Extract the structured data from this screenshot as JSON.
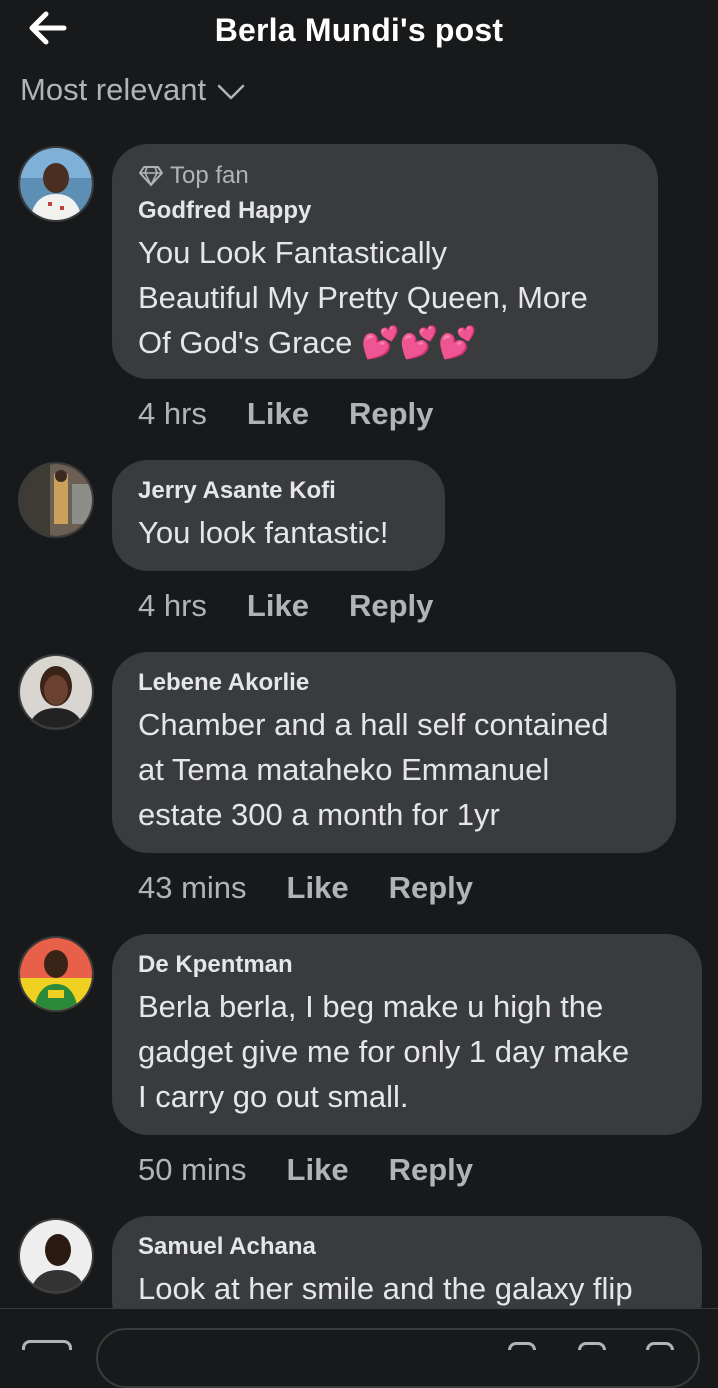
{
  "header": {
    "title": "Berla Mundi's post"
  },
  "sort": {
    "label": "Most relevant"
  },
  "comments": [
    {
      "badge": "Top fan",
      "name": "Godfred Happy",
      "lines": [
        "You Look Fantastically",
        "Beautiful My Pretty Queen, More",
        "Of God's Grace 💕💕💕"
      ],
      "time": "4 hrs",
      "like": "Like",
      "reply": "Reply"
    },
    {
      "name": "Jerry Asante Kofi",
      "lines": [
        "You look fantastic!"
      ],
      "time": "4 hrs",
      "like": "Like",
      "reply": "Reply"
    },
    {
      "name": "Lebene Akorlie",
      "lines": [
        "Chamber and a hall self contained",
        "at Tema mataheko Emmanuel",
        "estate 300 a month for 1yr"
      ],
      "time": "43 mins",
      "like": "Like",
      "reply": "Reply"
    },
    {
      "name": "De Kpentman",
      "lines": [
        "Berla berla, I beg make u high the",
        "gadget give me for  only 1 day make",
        "I carry go out small."
      ],
      "time": "50 mins",
      "like": "Like",
      "reply": "Reply"
    },
    {
      "name": "Samuel Achana",
      "lines": [
        "Look at her smile and the galaxy flip"
      ]
    }
  ],
  "colors": {
    "background": "#18191a",
    "bubble": "#3a3b3c",
    "text": "#e4e6eb",
    "muted": "#b0b3b8"
  }
}
